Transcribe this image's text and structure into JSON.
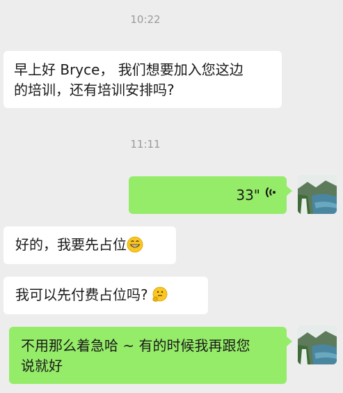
{
  "messages": {
    "time1": "10:22",
    "msg1_line1": "早上好 Bryce， 我们想要加入您这边",
    "msg1_line2": "的培训，还有培训安排吗?",
    "time2": "11:11",
    "voice_duration": "33\"",
    "msg3_text": "好的，我要先占位",
    "msg3_emoji": "grinning-face-emoji",
    "msg4_text": "我可以先付费占位吗?",
    "msg4_emoji": "thinking-face-emoji",
    "msg5_line1": "不用那么着急哈 ~ 有的时候我再跟您",
    "msg5_line2": "说就好"
  },
  "colors": {
    "background": "#ededed",
    "incoming_bubble": "#ffffff",
    "outgoing_bubble": "#95ec69",
    "timestamp_text": "#9a9a9a",
    "message_text": "#191919"
  },
  "icons": {
    "voice": "voice-wave-icon",
    "avatar": "landscape-avatar"
  }
}
